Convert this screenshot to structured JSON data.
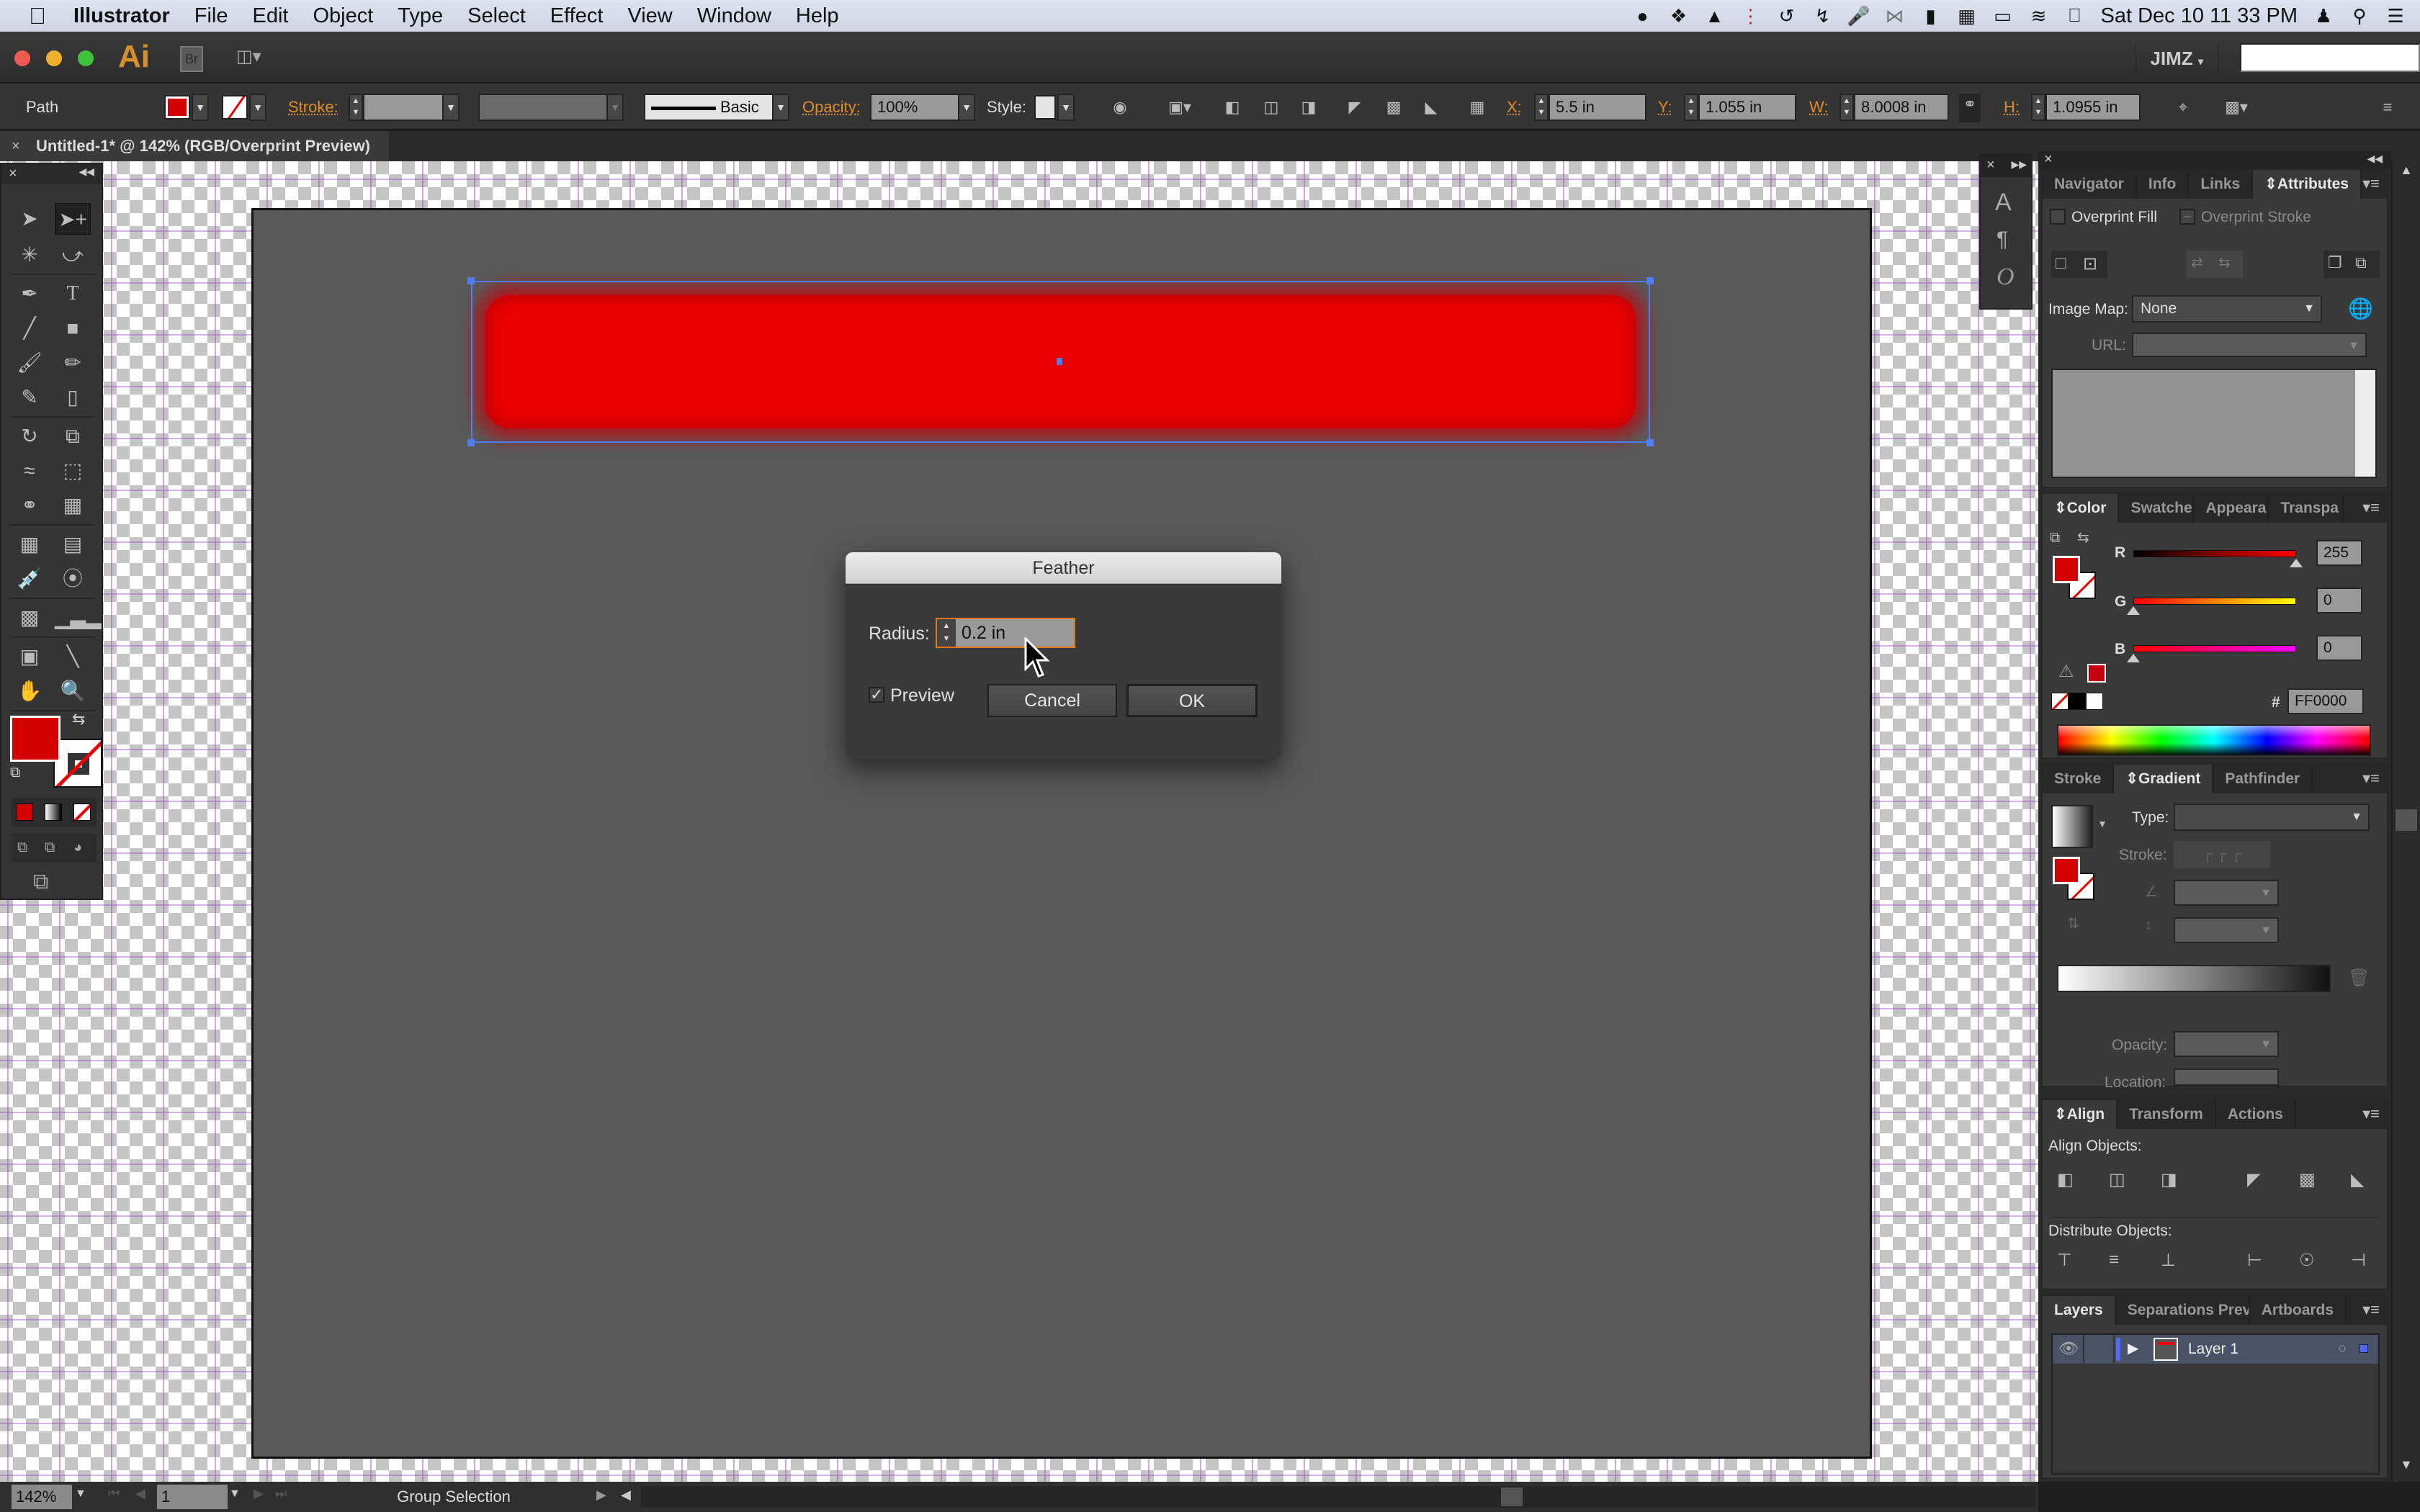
{
  "menubar": {
    "app_name": "Illustrator",
    "items": [
      "File",
      "Edit",
      "Object",
      "Type",
      "Select",
      "Effect",
      "View",
      "Window",
      "Help"
    ],
    "clock": "Sat Dec 10  11 33 PM",
    "status_icons": [
      "evernote-icon",
      "dropbox-icon",
      "google-drive-icon",
      "istat-icon",
      "time-machine-icon",
      "scrivener-icon",
      "microphone-icon",
      "bluetooth-icon",
      "battery-menu-icon",
      "clipboard-icon",
      "airplay-icon",
      "wifi-icon",
      "battery-icon",
      "user-icon",
      "spotlight-icon",
      "notification-center-icon"
    ]
  },
  "titlebar": {
    "logo": "Ai",
    "bridge_label": "Br",
    "workspace": "JIMZ",
    "search_value": ""
  },
  "controlbar": {
    "selection_type": "Path",
    "fill_color": "#D40000",
    "stroke_label": "Stroke:",
    "stroke_weight": "",
    "variable_width": "",
    "brush_label": "Basic",
    "opacity_label": "Opacity:",
    "opacity_value": "100%",
    "style_label": "Style:",
    "x_label": "X:",
    "x_value": "5.5 in",
    "y_label": "Y:",
    "y_value": "1.055 in",
    "w_label": "W:",
    "w_value": "8.0008 in",
    "h_label": "H:",
    "h_value": "1.0955 in"
  },
  "document": {
    "tab_title": "Untitled-1* @ 142% (RGB/Overprint Preview)",
    "object_color": "#EA0000"
  },
  "dialog": {
    "title": "Feather",
    "radius_label": "Radius:",
    "radius_value": "0.2 in",
    "preview_label": "Preview",
    "preview_checked": true,
    "cancel_label": "Cancel",
    "ok_label": "OK"
  },
  "panels": {
    "attributes": {
      "tabs": [
        "Navigator",
        "Info",
        "Links",
        "Attributes"
      ],
      "active_tab": "Attributes",
      "overprint_fill_label": "Overprint Fill",
      "overprint_stroke_label": "Overprint Stroke",
      "image_map_label": "Image Map:",
      "image_map_value": "None",
      "url_label": "URL:",
      "url_value": ""
    },
    "color": {
      "tabs": [
        "Color",
        "Swatches",
        "Appearance",
        "Transparency"
      ],
      "tab_display": [
        "Color",
        "Swatche:",
        "Appeara",
        "Transpa"
      ],
      "active_tab": "Color",
      "r_label": "R",
      "r_value": "255",
      "r_level": 1.0,
      "g_label": "G",
      "g_value": "0",
      "g_level": 0.0,
      "b_label": "B",
      "b_value": "0",
      "b_level": 0.0,
      "hex_label": "#",
      "hex_value": "FF0000",
      "fill_swatch": "#D40000",
      "out_of_gamut_swatch": "#C80010"
    },
    "gradient": {
      "tabs": [
        "Stroke",
        "Gradient",
        "Pathfinder"
      ],
      "active_tab": "Gradient",
      "type_label": "Type:",
      "type_value": "",
      "stroke_label": "Stroke:",
      "angle_value": "",
      "aspect_value": "",
      "opacity_label": "Opacity:",
      "opacity_value": "",
      "location_label": "Location:",
      "location_value": ""
    },
    "align": {
      "tabs": [
        "Align",
        "Transform",
        "Actions"
      ],
      "active_tab": "Align",
      "align_objects_label": "Align Objects:",
      "distribute_objects_label": "Distribute Objects:"
    },
    "layers": {
      "tabs": [
        "Layers",
        "Separations Preview",
        "Artboards"
      ],
      "tab_display": [
        "Layers",
        "Separations Previ",
        "Artboards"
      ],
      "active_tab": "Layers",
      "layers": [
        {
          "name": "Layer 1",
          "visible": true,
          "color": "#4F6BFF"
        }
      ]
    }
  },
  "statusbar": {
    "zoom_value": "142%",
    "artboard_number": "1",
    "status_text": "Group Selection"
  }
}
